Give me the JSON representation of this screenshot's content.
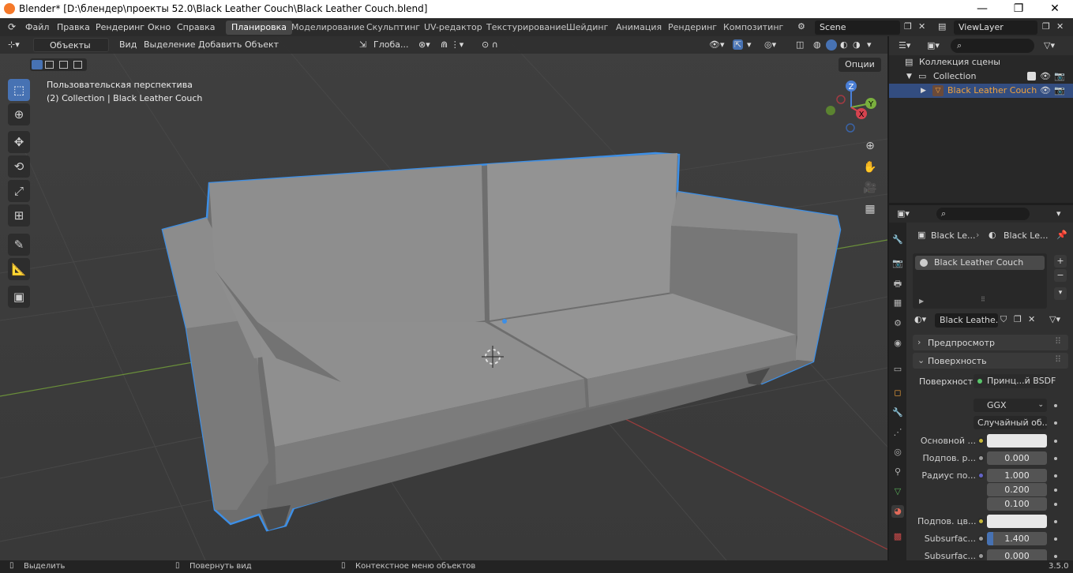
{
  "titlebar": {
    "title": "Blender* [D:\\блендер\\проекты 52.0\\Black Leather Couch\\Black Leather Couch.blend]",
    "minimize": "—",
    "maximize": "❐",
    "close": "✕"
  },
  "menu": {
    "file": "Файл",
    "edit": "Правка",
    "render": "Рендеринг",
    "window": "Окно",
    "help": "Справка"
  },
  "workspaces": [
    "Планировка",
    "Моделирование",
    "Скульптинг",
    "UV-редактор",
    "Текстурирование",
    "Шейдинг",
    "Анимация",
    "Рендеринг",
    "Композитинг"
  ],
  "scene": {
    "name": "Scene",
    "view_layer": "ViewLayer"
  },
  "viewport": {
    "mode": "Объекты",
    "menus": [
      "Вид",
      "Выделение",
      "Добавить",
      "Объект"
    ],
    "orientation": "Глоба...",
    "options": "Опции",
    "perspective": "Пользовательская перспектива",
    "collection_info": "(2) Collection | Black Leather Couch",
    "gizmo": {
      "x": "X",
      "y": "Y",
      "z": "Z"
    }
  },
  "outliner": {
    "scene_collection": "Коллекция сцены",
    "collection": "Collection",
    "object": "Black Leather Couch"
  },
  "properties": {
    "breadcrumb_object": "Black Le...",
    "breadcrumb_material": "Black Le...",
    "slot": "Black Leather Couch",
    "material_name": "Black Leathe...",
    "panel_preview": "Предпросмотр",
    "panel_surface": "Поверхность",
    "surface_label": "Поверхность",
    "surface_value": "Принц...й BSDF",
    "distribution": "GGX",
    "subsurface_method": "Случайный об...",
    "rows": [
      {
        "label": "Основной ...",
        "value": "",
        "kind": "color"
      },
      {
        "label": "Подпов. р...",
        "value": "0.000",
        "kind": "num"
      },
      {
        "label": "Радиус по...",
        "value": "1.000",
        "kind": "num"
      },
      {
        "label": "",
        "value": "0.200",
        "kind": "num"
      },
      {
        "label": "",
        "value": "0.100",
        "kind": "num"
      },
      {
        "label": "Подпов. цв...",
        "value": "",
        "kind": "color"
      },
      {
        "label": "Subsurfac...",
        "value": "1.400",
        "kind": "num"
      },
      {
        "label": "Subsurfac...",
        "value": "0.000",
        "kind": "num"
      }
    ]
  },
  "status": {
    "select": "Выделить",
    "rotate": "Повернуть вид",
    "context": "Контекстное меню объектов",
    "version": "3.5.0"
  },
  "colors": {
    "accent": "#4772b3",
    "selection_outline": "#3d8fe6",
    "active_object": "#f1a23b"
  }
}
